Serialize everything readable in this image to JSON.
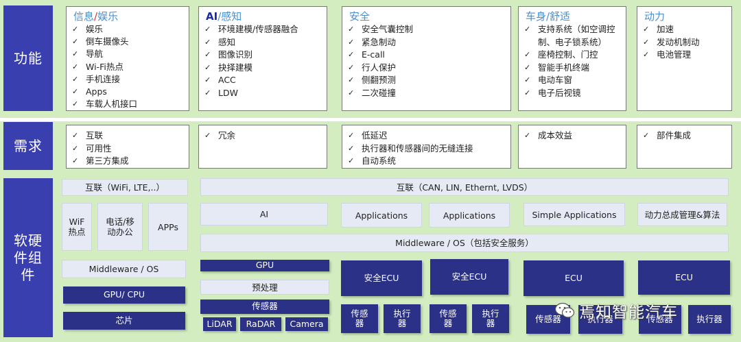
{
  "rows": {
    "functions_label": "功能",
    "needs_label": "需求",
    "components_label": "软硬件组件"
  },
  "functions": [
    {
      "title_parts": [
        "信息",
        "/",
        "娱乐"
      ],
      "items": [
        "娱乐",
        "倒车摄像头",
        "导航",
        "Wi-Fi热点",
        "手机连接",
        "Apps",
        "车载人机接口"
      ]
    },
    {
      "title_parts": [
        "AI",
        "/感知"
      ],
      "items": [
        "环境建模/传感器融合",
        "感知",
        "图像识别",
        "抉择建模",
        "ACC",
        "LDW"
      ]
    },
    {
      "title": "安全",
      "items": [
        "安全气囊控制",
        "紧急制动",
        "E-call",
        "行人保护",
        "侧翻预测",
        "二次碰撞"
      ]
    },
    {
      "title": "车身/舒适",
      "items": [
        "支持系统（如空调控制、电子锁系统）",
        "座椅控制、门控",
        "智能手机终端",
        "电动车窗",
        "电子后视镜"
      ]
    },
    {
      "title": "动力",
      "items": [
        "加速",
        "发动机制动",
        "电池管理"
      ]
    }
  ],
  "needs": [
    [
      "互联",
      "可用性",
      "第三方集成"
    ],
    [
      "冗余"
    ],
    [
      "低延迟",
      "执行器和传感器间的无缝连接",
      "自动系统"
    ],
    [
      "成本效益"
    ],
    [
      "部件集成"
    ]
  ],
  "components": {
    "col1": {
      "connect": "互联（WiFi, LTE,..）",
      "wifi": "WiF热点",
      "phone": "电话/移动办公",
      "apps": "APPs",
      "middleware": "Middleware / OS",
      "gpu_cpu": "GPU/ CPU",
      "chip": "芯片"
    },
    "main": {
      "connect": "互联（CAN, LIN, Ethernt, LVDS）",
      "ai": "AI",
      "applications_1": "Applications",
      "applications_2": "Applications",
      "simple_apps": "Simple Applications",
      "power_mgmt": "动力总成管理&算法",
      "middleware": "Middleware / OS（包括安全服务）",
      "gpu": "GPU",
      "preprocess": "预处理",
      "sensor": "传感器",
      "lidar": "LiDAR",
      "radar": "RaDAR",
      "camera": "Camera",
      "safety_ecu_1": "安全ECU",
      "safety_ecu_2": "安全ECU",
      "ecu_1": "ECU",
      "ecu_2": "ECU",
      "sensor_a": "传感器",
      "actuator_a": "执行器",
      "sensor_b": "传感器",
      "actuator_b": "执行器",
      "sensor_c": "传感器",
      "actuator_c": "执行器",
      "sensor_d": "传感器",
      "actuator_d": "执行器"
    }
  },
  "watermark": "焉知智能汽车",
  "colors": {
    "band": "#d3edc0",
    "label_bg": "#3a3fb0",
    "dark_box": "#2b3186",
    "light_box": "#e6eaf5",
    "title_blue": "#4a8fd2",
    "title_navy": "#1c2aa8"
  }
}
